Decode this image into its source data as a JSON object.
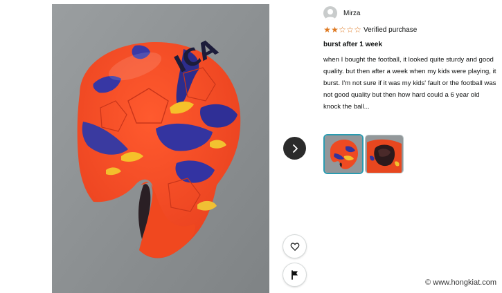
{
  "reviewer": {
    "name": "Mirza",
    "avatar_icon": "user-avatar-icon"
  },
  "rating": {
    "stars": 2,
    "max": 5,
    "star_glyph_on": "★",
    "star_glyph_off": "☆",
    "star_color": "#de7921",
    "verified_label": "Verified purchase"
  },
  "review": {
    "title": "burst after 1 week",
    "body": "when I bought the football, it looked quite sturdy and good quality. but then after a week when my kids were playing, it burst. I'm not sure if it was my kids' fault or the football was not good quality but then how hard could a 6 year old knock the ball..."
  },
  "media": {
    "main_image_icon": "burst-football-photo",
    "next_icon": "chevron-right-icon",
    "like_icon": "heart-icon",
    "report_icon": "flag-icon",
    "thumbnails": [
      {
        "icon": "burst-football-thumbnail",
        "selected": true
      },
      {
        "icon": "football-hole-thumbnail",
        "selected": false
      }
    ],
    "selected_color": "#2a9bb0"
  },
  "watermark": {
    "icon": "copyright-icon",
    "glyph": "©",
    "text": "www.hongkiat.com"
  }
}
